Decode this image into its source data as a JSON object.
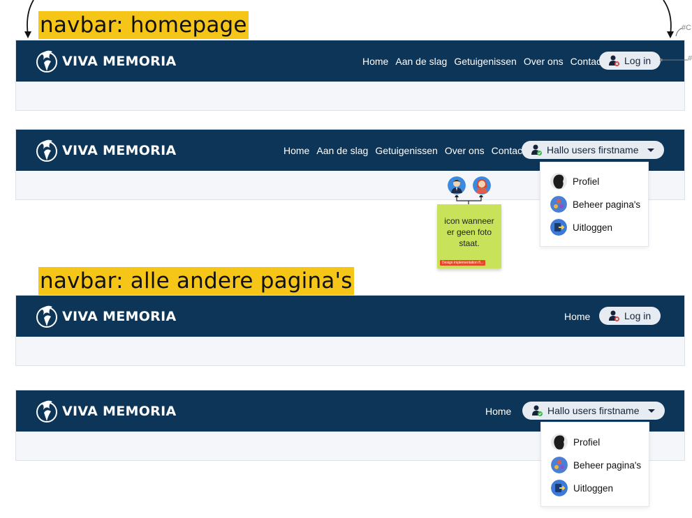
{
  "annotations": {
    "homepage_title": "navbar: homepage",
    "other_pages_title": "navbar: alle andere pagina's",
    "sticky_note": "icon wanneer er geen foto staat.",
    "sticky_tag": "Design implementation fl...",
    "edge_label_top": "#C",
    "edge_label_mid": "#"
  },
  "brand": {
    "name": "VIVA MEMORIA"
  },
  "navbar_homepage": {
    "links": [
      "Home",
      "Aan de slag",
      "Getuigenissen",
      "Over ons",
      "Contact"
    ],
    "login_label": "Log in"
  },
  "navbar_homepage_logged_in": {
    "links": [
      "Home",
      "Aan de slag",
      "Getuigenissen",
      "Over ons",
      "Contact"
    ],
    "user_label": "Hallo users firstname"
  },
  "navbar_other": {
    "links": [
      "Home"
    ],
    "login_label": "Log in"
  },
  "navbar_other_logged_in": {
    "links": [
      "Home"
    ],
    "user_label": "Hallo users firstname"
  },
  "user_menu": {
    "items": [
      {
        "label": "Profiel",
        "icon": "profile-photo-icon"
      },
      {
        "label": "Beheer pagina's",
        "icon": "manage-pages-icon"
      },
      {
        "label": "Uitloggen",
        "icon": "logout-icon"
      }
    ]
  },
  "colors": {
    "navbar_bg": "#0d3558",
    "highlight": "#f5c518",
    "pill_bg": "#e7ecf2",
    "sticky_note": "#c8e25a"
  }
}
